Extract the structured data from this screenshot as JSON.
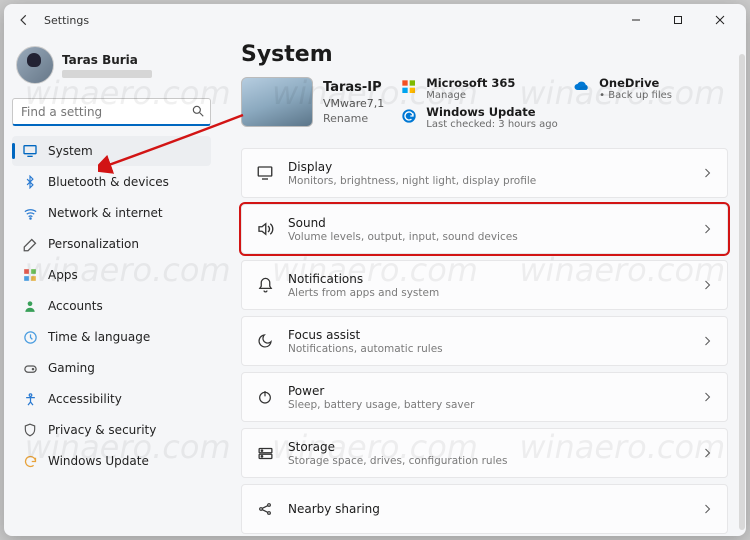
{
  "titlebar": {
    "title": "Settings"
  },
  "profile": {
    "name": "Taras Buria"
  },
  "search": {
    "placeholder": "Find a setting"
  },
  "sidebar": {
    "items": [
      {
        "label": "System",
        "active": true
      },
      {
        "label": "Bluetooth & devices"
      },
      {
        "label": "Network & internet"
      },
      {
        "label": "Personalization"
      },
      {
        "label": "Apps"
      },
      {
        "label": "Accounts"
      },
      {
        "label": "Time & language"
      },
      {
        "label": "Gaming"
      },
      {
        "label": "Accessibility"
      },
      {
        "label": "Privacy & security"
      },
      {
        "label": "Windows Update"
      }
    ]
  },
  "page": {
    "title": "System"
  },
  "pc": {
    "name": "Taras-IP",
    "model": "VMware7,1",
    "rename": "Rename"
  },
  "quicklinks": {
    "a": {
      "title": "Microsoft 365",
      "sub": "Manage"
    },
    "b": {
      "title": "OneDrive",
      "sub": "• Back up files"
    },
    "c": {
      "title": "Windows Update",
      "sub": "Last checked: 3 hours ago"
    }
  },
  "rows": [
    {
      "title": "Display",
      "sub": "Monitors, brightness, night light, display profile"
    },
    {
      "title": "Sound",
      "sub": "Volume levels, output, input, sound devices",
      "highlight": true
    },
    {
      "title": "Notifications",
      "sub": "Alerts from apps and system"
    },
    {
      "title": "Focus assist",
      "sub": "Notifications, automatic rules"
    },
    {
      "title": "Power",
      "sub": "Sleep, battery usage, battery saver"
    },
    {
      "title": "Storage",
      "sub": "Storage space, drives, configuration rules"
    },
    {
      "title": "Nearby sharing",
      "sub": ""
    }
  ],
  "watermark": "winaero.com"
}
